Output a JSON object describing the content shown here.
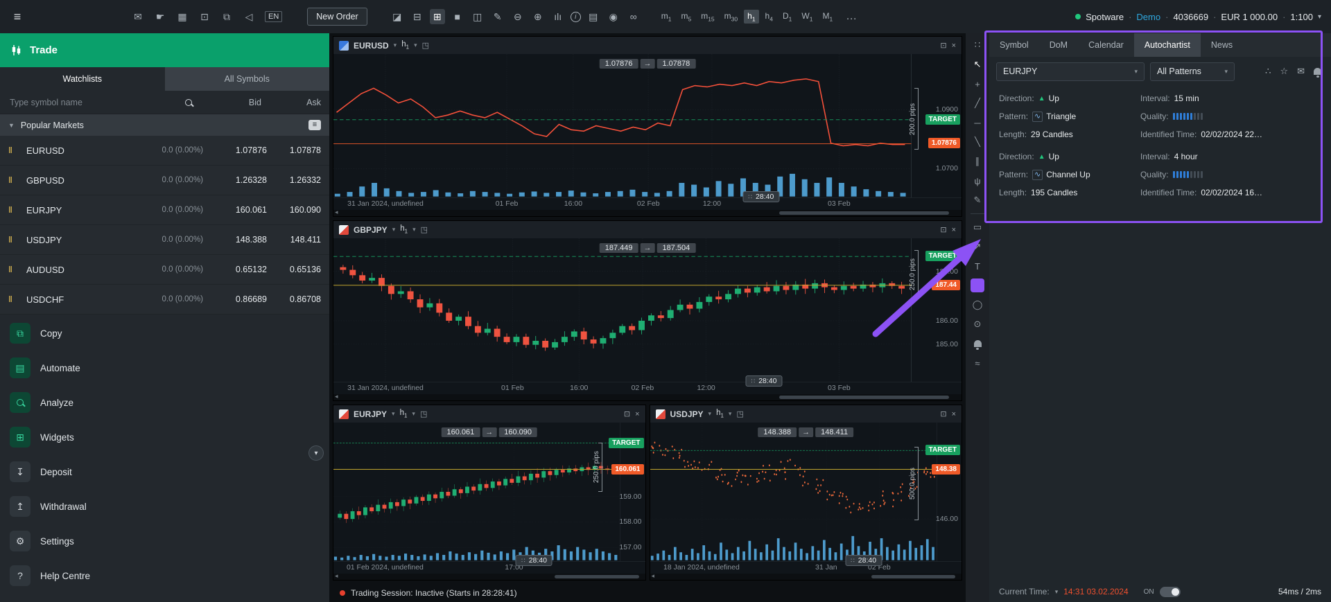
{
  "topbar": {
    "left_icons": [
      {
        "name": "hamburger-menu-icon",
        "glyph": "≡"
      },
      {
        "name": "envelope-icon",
        "glyph": "✉"
      },
      {
        "name": "pointer-hand-icon",
        "glyph": "☛"
      },
      {
        "name": "gift-icon",
        "glyph": "▦"
      },
      {
        "name": "crop-icon",
        "glyph": "⊡"
      },
      {
        "name": "copy-icon",
        "glyph": "⧉"
      },
      {
        "name": "volume-icon",
        "glyph": "◁"
      }
    ],
    "language_badge": "EN",
    "new_order_label": "New Order",
    "tool_icons": [
      {
        "name": "chart-window-icon",
        "glyph": "◪"
      },
      {
        "name": "layout-panels-icon",
        "glyph": "⊟"
      },
      {
        "name": "grid-2x2-icon",
        "glyph": "⊞",
        "active": true
      },
      {
        "name": "single-pane-icon",
        "glyph": "■"
      },
      {
        "name": "split-pane-icon",
        "glyph": "◫"
      },
      {
        "name": "chart-edit-icon",
        "glyph": "✎"
      },
      {
        "name": "zoom-out-icon",
        "glyph": "⊖"
      },
      {
        "name": "zoom-in-icon",
        "glyph": "⊕"
      },
      {
        "name": "volume-profile-icon",
        "glyph": "ılı"
      },
      {
        "name": "info-icon",
        "glyph": "i",
        "circle": true
      },
      {
        "name": "layers-icon",
        "glyph": "▤"
      },
      {
        "name": "eye-icon",
        "glyph": "◉"
      },
      {
        "name": "link-charts-icon",
        "glyph": "∞"
      }
    ],
    "timeframes": [
      {
        "unit": "m",
        "sub": "1"
      },
      {
        "unit": "m",
        "sub": "5"
      },
      {
        "unit": "m",
        "sub": "15"
      },
      {
        "unit": "m",
        "sub": "30"
      },
      {
        "unit": "h",
        "sub": "1",
        "active": true
      },
      {
        "unit": "h",
        "sub": "4"
      },
      {
        "unit": "D",
        "sub": "1"
      },
      {
        "unit": "W",
        "sub": "1"
      },
      {
        "unit": "M",
        "sub": "1"
      }
    ],
    "more_label": "…",
    "account": {
      "broker": "Spotware",
      "environment": "Demo",
      "account_id": "4036669",
      "balance": "EUR 1 000.00",
      "leverage": "1:100"
    }
  },
  "sidebar": {
    "trade_label": "Trade",
    "tabs": [
      {
        "label": "Watchlists",
        "active": true
      },
      {
        "label": "All Symbols",
        "active": false
      }
    ],
    "search_placeholder": "Type symbol name",
    "columns": {
      "bid": "Bid",
      "ask": "Ask"
    },
    "group_header": "Popular Markets",
    "symbols": [
      {
        "name": "EURUSD",
        "change": "0.0 (0.00%)",
        "bid": "1.07876",
        "ask": "1.07878"
      },
      {
        "name": "GBPUSD",
        "change": "0.0 (0.00%)",
        "bid": "1.26328",
        "ask": "1.26332"
      },
      {
        "name": "EURJPY",
        "change": "0.0 (0.00%)",
        "bid": "160.061",
        "ask": "160.090"
      },
      {
        "name": "USDJPY",
        "change": "0.0 (0.00%)",
        "bid": "148.388",
        "ask": "148.411"
      },
      {
        "name": "AUDUSD",
        "change": "0.0 (0.00%)",
        "bid": "0.65132",
        "ask": "0.65136"
      },
      {
        "name": "USDCHF",
        "change": "0.0 (0.00%)",
        "bid": "0.86689",
        "ask": "0.86708"
      }
    ],
    "menu": [
      {
        "label": "Copy",
        "icon": "copy",
        "glyph": "⧉",
        "green": true
      },
      {
        "label": "Automate",
        "icon": "automate",
        "glyph": "▤",
        "green": true
      },
      {
        "label": "Analyze",
        "icon": "analyze",
        "glyph": "",
        "green": true
      },
      {
        "label": "Widgets",
        "icon": "widgets",
        "glyph": "⊞",
        "green": true
      },
      {
        "label": "Deposit",
        "icon": "deposit",
        "glyph": "↧",
        "green": false
      },
      {
        "label": "Withdrawal",
        "icon": "withdrawal",
        "glyph": "↥",
        "green": false
      },
      {
        "label": "Settings",
        "icon": "settings",
        "glyph": "⚙",
        "green": false
      },
      {
        "label": "Help Centre",
        "icon": "help",
        "glyph": "?",
        "green": false
      }
    ]
  },
  "charts": [
    {
      "symbol": "EURUSD",
      "flag": "blue",
      "tf": "h",
      "tf_sub": "1",
      "float_bid": "1.07876",
      "float_ask": "1.07878",
      "type": "line",
      "sparkline": [
        0.6,
        0.67,
        0.74,
        0.78,
        0.73,
        0.67,
        0.7,
        0.64,
        0.56,
        0.58,
        0.61,
        0.58,
        0.56,
        0.6,
        0.55,
        0.5,
        0.44,
        0.42,
        0.51,
        0.47,
        0.46,
        0.5,
        0.48,
        0.46,
        0.49,
        0.47,
        0.52,
        0.5,
        0.77,
        0.8,
        0.79,
        0.81,
        0.8,
        0.82,
        0.8,
        0.83,
        0.82,
        0.84,
        0.85,
        0.83,
        0.37,
        0.35,
        0.36,
        0.35,
        0.37,
        0.36,
        0.36
      ],
      "volume": [
        0.06,
        0.1,
        0.22,
        0.3,
        0.18,
        0.12,
        0.08,
        0.1,
        0.14,
        0.09,
        0.07,
        0.12,
        0.1,
        0.08,
        0.06,
        0.09,
        0.11,
        0.08,
        0.1,
        0.13,
        0.09,
        0.07,
        0.1,
        0.12,
        0.15,
        0.1,
        0.08,
        0.12,
        0.3,
        0.26,
        0.2,
        0.34,
        0.28,
        0.4,
        0.3,
        0.26,
        0.44,
        0.5,
        0.38,
        0.3,
        0.42,
        0.3,
        0.22,
        0.16,
        0.12,
        0.1,
        0.08
      ],
      "y_ticks": [
        {
          "label": "1.0900",
          "p": 0.62
        },
        {
          "label": "1.0700",
          "p": 0.18
        }
      ],
      "target": {
        "label": "TARGET",
        "p": 0.545
      },
      "price": {
        "label": "1.07876",
        "p": 0.366
      },
      "orange_line": 0.366,
      "pips": "200.0 pips",
      "pips_span": [
        0.78,
        0.32
      ],
      "x_ticks": [
        {
          "label": "31 Jan 2024, undefined",
          "p": 0.09
        },
        {
          "label": "01 Feb",
          "p": 0.3
        },
        {
          "label": "16:00",
          "p": 0.415
        },
        {
          "label": "02 Feb",
          "p": 0.545
        },
        {
          "label": "12:00",
          "p": 0.655
        },
        {
          "label": "03 Feb",
          "p": 0.875
        }
      ],
      "countdown": {
        "label": "28:40",
        "p": 0.74
      }
    },
    {
      "symbol": "GBPJPY",
      "flag": "red",
      "tf": "h",
      "tf_sub": "1",
      "float_bid": "187.449",
      "float_ask": "187.504",
      "type": "candles",
      "sparkline": [
        0.82,
        0.8,
        0.76,
        0.72,
        0.74,
        0.68,
        0.62,
        0.64,
        0.58,
        0.52,
        0.55,
        0.48,
        0.42,
        0.45,
        0.38,
        0.33,
        0.36,
        0.3,
        0.26,
        0.3,
        0.24,
        0.27,
        0.22,
        0.26,
        0.3,
        0.34,
        0.28,
        0.25,
        0.29,
        0.33,
        0.38,
        0.35,
        0.42,
        0.46,
        0.44,
        0.5,
        0.54,
        0.51,
        0.56,
        0.6,
        0.58,
        0.62,
        0.66,
        0.63,
        0.67,
        0.64,
        0.68,
        0.65,
        0.69,
        0.66,
        0.7,
        0.67,
        0.65,
        0.68,
        0.66,
        0.69,
        0.67,
        0.7,
        0.68,
        0.66
      ],
      "volume": [],
      "y_ticks": [
        {
          "label": "188.00",
          "p": 0.79
        },
        {
          "label": "186.00",
          "p": 0.42
        },
        {
          "label": "185.00",
          "p": 0.245
        }
      ],
      "target": {
        "label": "TARGET",
        "p": 0.9
      },
      "price": {
        "label": "187.44",
        "p": 0.685
      },
      "yellow_line": 0.685,
      "pips": "250.0 pips",
      "pips_span": [
        0.95,
        0.58
      ],
      "x_ticks": [
        {
          "label": "31 Jan 2024, undefined",
          "p": 0.09
        },
        {
          "label": "01 Feb",
          "p": 0.31
        },
        {
          "label": "16:00",
          "p": 0.425
        },
        {
          "label": "02 Feb",
          "p": 0.535
        },
        {
          "label": "12:00",
          "p": 0.645
        },
        {
          "label": "03 Feb",
          "p": 0.875
        }
      ],
      "countdown": {
        "label": "28:40",
        "p": 0.745
      }
    },
    {
      "symbol": "EURJPY",
      "flag": "red",
      "tf": "h",
      "tf_sub": "1",
      "float_bid": "160.061",
      "float_ask": "160.090",
      "type": "candles",
      "sparkline": [
        0.3,
        0.33,
        0.29,
        0.35,
        0.32,
        0.38,
        0.35,
        0.4,
        0.37,
        0.42,
        0.39,
        0.44,
        0.41,
        0.46,
        0.43,
        0.48,
        0.45,
        0.5,
        0.47,
        0.52,
        0.49,
        0.54,
        0.51,
        0.56,
        0.53,
        0.58,
        0.55,
        0.6,
        0.57,
        0.62,
        0.59,
        0.64,
        0.61,
        0.66,
        0.63,
        0.67,
        0.65,
        0.68,
        0.66,
        0.69,
        0.67,
        0.7,
        0.68,
        0.67,
        0.68
      ],
      "volume": [
        0.08,
        0.06,
        0.1,
        0.07,
        0.12,
        0.09,
        0.14,
        0.1,
        0.08,
        0.12,
        0.1,
        0.15,
        0.12,
        0.09,
        0.13,
        0.1,
        0.16,
        0.12,
        0.2,
        0.15,
        0.12,
        0.18,
        0.14,
        0.22,
        0.17,
        0.13,
        0.2,
        0.16,
        0.24,
        0.18,
        0.3,
        0.22,
        0.17,
        0.26,
        0.2,
        0.34,
        0.25,
        0.2,
        0.3,
        0.24,
        0.18,
        0.26,
        0.2,
        0.16,
        0.12
      ],
      "y_ticks": [
        {
          "label": "159.00",
          "p": 0.464
        },
        {
          "label": "158.00",
          "p": 0.268
        },
        {
          "label": "157.00",
          "p": 0.07
        }
      ],
      "target": {
        "label": "TARGET",
        "p": 0.877
      },
      "price": {
        "label": "160.061",
        "p": 0.674
      },
      "yellow_line": 0.674,
      "pips": "250.0 pips",
      "pips_span": [
        0.88,
        0.5
      ],
      "x_ticks": [
        {
          "label": "01 Feb 2024, undefined",
          "p": 0.18
        },
        {
          "label": "17:00",
          "p": 0.63
        }
      ],
      "countdown": {
        "label": "28:40",
        "p": 0.7
      }
    },
    {
      "symbol": "USDJPY",
      "flag": "red",
      "tf": "h",
      "tf_sub": "1",
      "float_bid": "148.388",
      "float_ask": "148.411",
      "type": "dots",
      "sparkline": [
        0.85,
        0.83,
        0.8,
        0.82,
        0.78,
        0.75,
        0.77,
        0.73,
        0.7,
        0.72,
        0.68,
        0.65,
        0.67,
        0.63,
        0.6,
        0.62,
        0.58,
        0.6,
        0.57,
        0.62,
        0.66,
        0.64,
        0.68,
        0.66,
        0.7,
        0.67,
        0.63,
        0.6,
        0.57,
        0.54,
        0.5,
        0.47,
        0.44,
        0.46,
        0.42,
        0.39,
        0.41,
        0.38,
        0.4,
        0.37,
        0.42,
        0.45,
        0.43,
        0.48,
        0.52,
        0.55,
        0.58,
        0.62,
        0.65,
        0.67
      ],
      "volume": [
        0.1,
        0.15,
        0.22,
        0.12,
        0.3,
        0.18,
        0.12,
        0.26,
        0.16,
        0.34,
        0.2,
        0.14,
        0.4,
        0.24,
        0.16,
        0.3,
        0.2,
        0.44,
        0.26,
        0.18,
        0.36,
        0.22,
        0.5,
        0.3,
        0.2,
        0.4,
        0.26,
        0.16,
        0.32,
        0.22,
        0.46,
        0.28,
        0.18,
        0.38,
        0.24,
        0.55,
        0.32,
        0.2,
        0.42,
        0.26,
        0.5,
        0.3,
        0.22,
        0.36,
        0.24,
        0.44,
        0.28,
        0.34,
        0.48,
        0.3
      ],
      "y_ticks": [
        {
          "label": "146.00",
          "p": 0.29
        }
      ],
      "target": {
        "label": "TARGET",
        "p": 0.82
      },
      "price": {
        "label": "148.38",
        "p": 0.674
      },
      "yellow_line": 0.674,
      "pips": "500.0 pips",
      "pips_span": [
        0.85,
        0.28
      ],
      "x_ticks": [
        {
          "label": "18 Jan 2024, undefined",
          "p": 0.18
        },
        {
          "label": "31 Jan",
          "p": 0.615
        },
        {
          "label": "02 Feb",
          "p": 0.8
        }
      ],
      "countdown": {
        "label": "28:40",
        "p": 0.745
      }
    }
  ],
  "toolstrip": [
    {
      "name": "drag-handle-icon",
      "glyph": "∷"
    },
    {
      "name": "cursor-tool-icon",
      "glyph": "↖",
      "white": true
    },
    {
      "name": "crosshair-tool-icon",
      "glyph": "+"
    },
    {
      "name": "trend-line-tool-icon",
      "glyph": "╱"
    },
    {
      "name": "horizontal-line-tool-icon",
      "glyph": "─"
    },
    {
      "name": "ray-line-tool-icon",
      "glyph": "╲"
    },
    {
      "name": "channel-tool-icon",
      "glyph": "∥"
    },
    {
      "name": "pitchfork-tool-icon",
      "glyph": "ψ"
    },
    {
      "name": "brush-tool-icon",
      "glyph": "✎"
    },
    {
      "divider": true
    },
    {
      "name": "shapes-tool-icon",
      "glyph": "▭"
    },
    {
      "name": "arrow-tool-icon",
      "glyph": "↗"
    },
    {
      "name": "text-tool-icon",
      "glyph": "T"
    },
    {
      "name": "rectangle-tool-icon",
      "selected": true
    },
    {
      "name": "ellipse-tool-icon",
      "glyph": "◯"
    },
    {
      "name": "screenshot-camera-icon",
      "glyph": "⊙"
    },
    {
      "name": "alert-bell-icon",
      "bell": true
    },
    {
      "name": "patterns-tool-icon",
      "glyph": "≈"
    }
  ],
  "right_panel": {
    "tabs": [
      {
        "label": "Symbol"
      },
      {
        "label": "DoM"
      },
      {
        "label": "Calendar"
      },
      {
        "label": "Autochartist",
        "active": true
      },
      {
        "label": "News"
      }
    ],
    "symbol_select": "EURJPY",
    "pattern_select": "All Patterns",
    "header_icons": [
      {
        "name": "share-icon",
        "glyph": "∴"
      },
      {
        "name": "favorites-star-icon",
        "glyph": "☆"
      },
      {
        "name": "email-alert-icon",
        "glyph": "✉"
      },
      {
        "name": "notification-bell-icon",
        "bell": true
      }
    ],
    "labels": {
      "direction": "Direction:",
      "interval": "Interval:",
      "pattern": "Pattern:",
      "quality": "Quality:",
      "length": "Length:",
      "identified": "Identified Time:"
    },
    "patterns": [
      {
        "direction": "Up",
        "interval": "15 min",
        "pattern": "Triangle",
        "quality_lit": 6,
        "quality_total": 9,
        "length": "29 Candles",
        "identified": "02/02/2024 22…"
      },
      {
        "direction": "Up",
        "interval": "4 hour",
        "pattern": "Channel Up",
        "quality_lit": 5,
        "quality_total": 9,
        "length": "195 Candles",
        "identified": "02/02/2024 16…"
      }
    ]
  },
  "status": {
    "trading_session": "Trading Session: Inactive (Starts in 28:28:41)",
    "current_time_label": "Current Time:",
    "current_time": "14:31 03.02.2024",
    "toggle_label": "ON",
    "latency": "54ms / 2ms"
  },
  "annotation": {
    "color": "#8c52f5"
  }
}
